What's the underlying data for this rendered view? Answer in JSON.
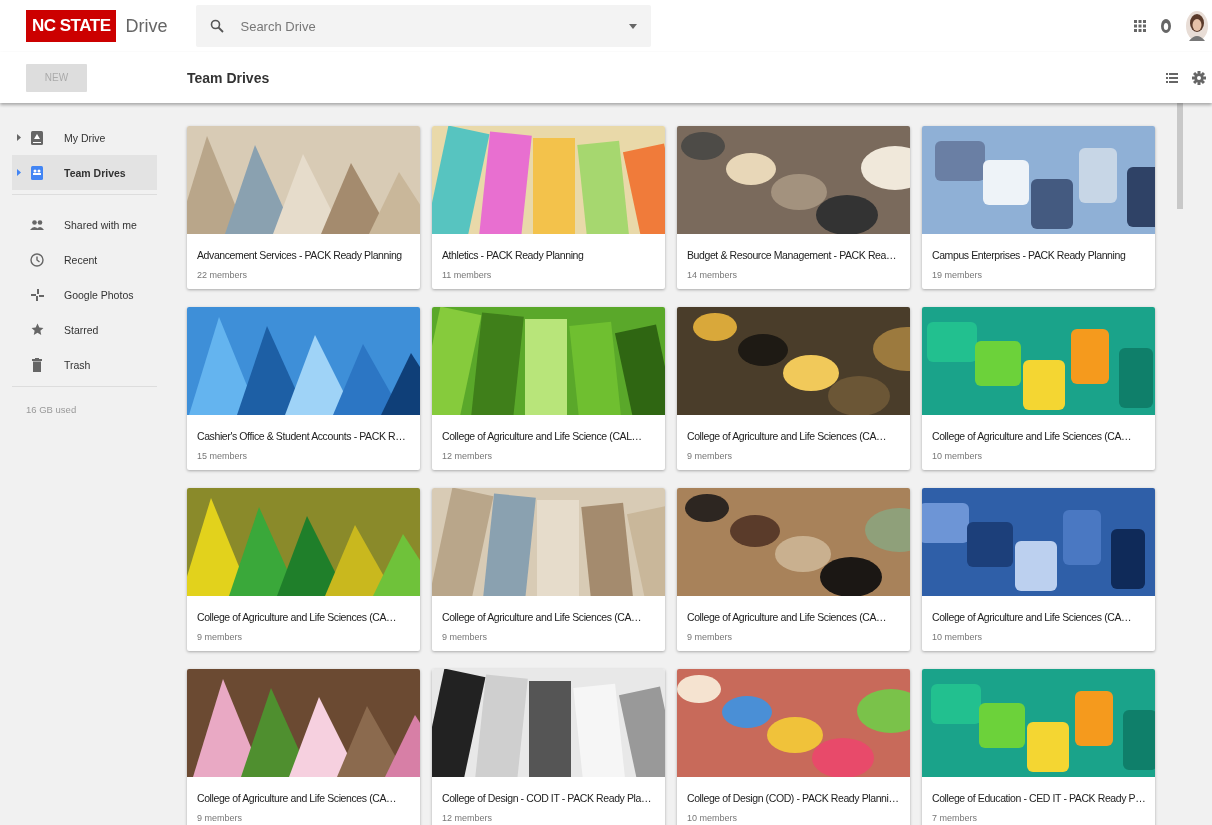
{
  "header": {
    "logo": "NC STATE",
    "app_name": "Drive",
    "search": {
      "placeholder": "Search Drive"
    }
  },
  "toolbar": {
    "new_button": "NEW",
    "title": "Team Drives"
  },
  "sidebar": {
    "items": [
      {
        "label": "My Drive",
        "selected": false,
        "expandable": true
      },
      {
        "label": "Team Drives",
        "selected": true,
        "expandable": true
      },
      {
        "label": "Shared with me",
        "selected": false,
        "expandable": false
      },
      {
        "label": "Recent",
        "selected": false,
        "expandable": false
      },
      {
        "label": "Google Photos",
        "selected": false,
        "expandable": false
      },
      {
        "label": "Starred",
        "selected": false,
        "expandable": false
      },
      {
        "label": "Trash",
        "selected": false,
        "expandable": false
      }
    ],
    "storage": "16 GB used"
  },
  "team_drives": [
    {
      "name": "Advancement Services - PACK Ready Planning",
      "members": "22 members"
    },
    {
      "name": "Athletics - PACK Ready Planning",
      "members": "11 members"
    },
    {
      "name": "Budget & Resource Management - PACK Rea…",
      "members": "14 members"
    },
    {
      "name": "Campus Enterprises - PACK Ready Planning",
      "members": "19 members"
    },
    {
      "name": "Cashier's Office & Student Accounts - PACK R…",
      "members": "15 members"
    },
    {
      "name": "College of Agriculture and Life Science (CAL…",
      "members": "12 members"
    },
    {
      "name": "College of Agriculture and Life Sciences (CA…",
      "members": "9 members"
    },
    {
      "name": "College of Agriculture and Life Sciences (CA…",
      "members": "10 members"
    },
    {
      "name": "College of Agriculture and Life Sciences (CA…",
      "members": "9 members"
    },
    {
      "name": "College of Agriculture and Life Sciences (CA…",
      "members": "9 members"
    },
    {
      "name": "College of Agriculture and Life Sciences (CA…",
      "members": "9 members"
    },
    {
      "name": "College of Agriculture and Life Sciences (CA…",
      "members": "10 members"
    },
    {
      "name": "College of Agriculture and Life Sciences (CA…",
      "members": "9 members"
    },
    {
      "name": "College of Design - COD IT - PACK Ready Pla…",
      "members": "12 members"
    },
    {
      "name": "College of Design (COD) - PACK Ready Planni…",
      "members": "10 members"
    },
    {
      "name": "College of Education - CED IT - PACK Ready P…",
      "members": "7 members"
    }
  ]
}
